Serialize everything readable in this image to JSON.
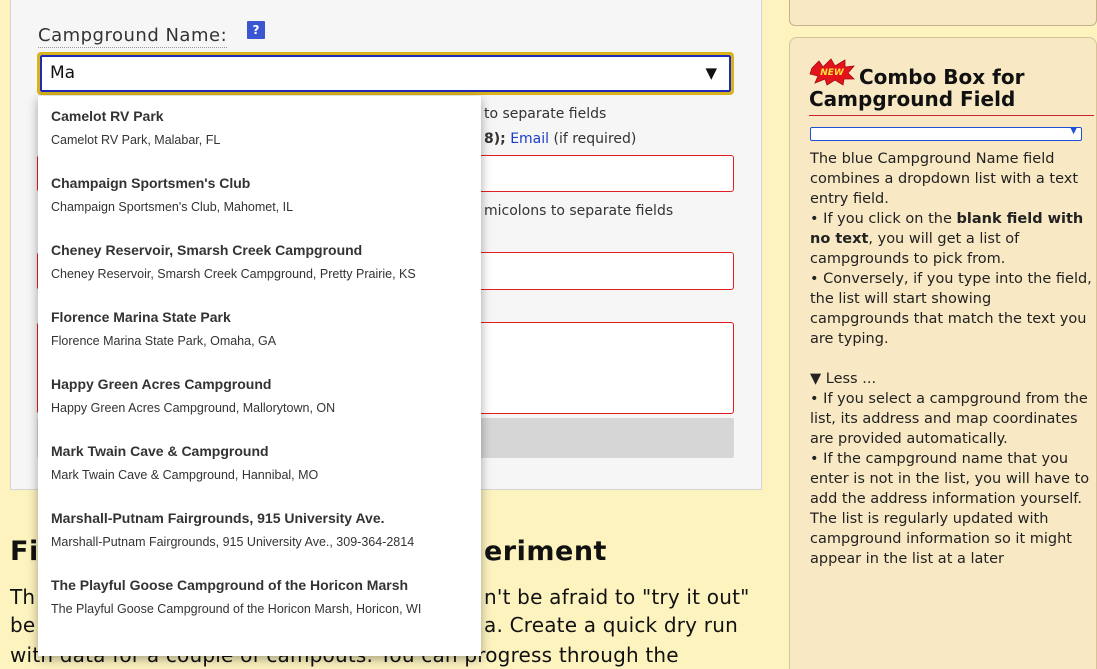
{
  "form": {
    "campground_label": "Campground Name:",
    "help_label": "?",
    "campground_value": "Ma",
    "dropdown_arrow": "▼",
    "hint1_tail": "to separate fields",
    "hint2_tail": "8);",
    "hint2_email": "Email",
    "hint2_rest": "(if required)",
    "hint3_tail": "micolons to separate fields"
  },
  "dropdown": {
    "options": [
      {
        "title": "Camelot RV Park",
        "subtitle": "Camelot RV Park, Malabar, FL"
      },
      {
        "title": "Champaign Sportsmen's Club",
        "subtitle": "Champaign Sportsmen's Club, Mahomet, IL"
      },
      {
        "title": "Cheney Reservoir, Smarsh Creek Campground",
        "subtitle": "Cheney Reservoir, Smarsh Creek Campground, Pretty Prairie, KS"
      },
      {
        "title": "Florence Marina State Park",
        "subtitle": "Florence Marina State Park, Omaha, GA"
      },
      {
        "title": "Happy Green Acres Campground",
        "subtitle": "Happy Green Acres Campground, Mallorytown, ON"
      },
      {
        "title": "Mark Twain Cave & Campground",
        "subtitle": "Mark Twain Cave & Campground, Hannibal, MO"
      },
      {
        "title": "Marshall-Putnam Fairgrounds, 915 University Ave.",
        "subtitle": "Marshall-Putnam Fairgrounds, 915 University Ave., 309-364-2814"
      },
      {
        "title": "The Playful Goose Campground of the Horicon Marsh",
        "subtitle": "The Playful Goose Campground of the Horicon Marsh, Horicon, WI"
      }
    ]
  },
  "body": {
    "heading_left": "Fi",
    "heading_right": "eriment",
    "line1_left": "Th",
    "line1_right": "n't be afraid to \"try it out\"",
    "line2_left": "be",
    "line2_right": "a. Create a quick dry run",
    "line3": "with data for a couple of campouts. You can progress through the"
  },
  "sidebar": {
    "new_badge": "NEW",
    "title": "Combo Box for Campground Field",
    "para1": "The blue Campground Name field combines a dropdown list with a text entry field.",
    "para2_pre": "• If you click on the ",
    "para2_bold": "blank field with no text",
    "para2_post": ", you will get a list of campgrounds to pick from.",
    "para3": "• Conversely, if you type into the field, the list will start showing campgrounds that match the text you are typing.",
    "less": "▼ Less ...",
    "para4": "• If you select a campground from the list, its address and map coordinates are provided automatically.",
    "para5": "• If the campground name that you enter is not in the list, you will have to add the address information yourself.",
    "para6": "The list is regularly updated with campground information so it might appear in the list at a later"
  }
}
